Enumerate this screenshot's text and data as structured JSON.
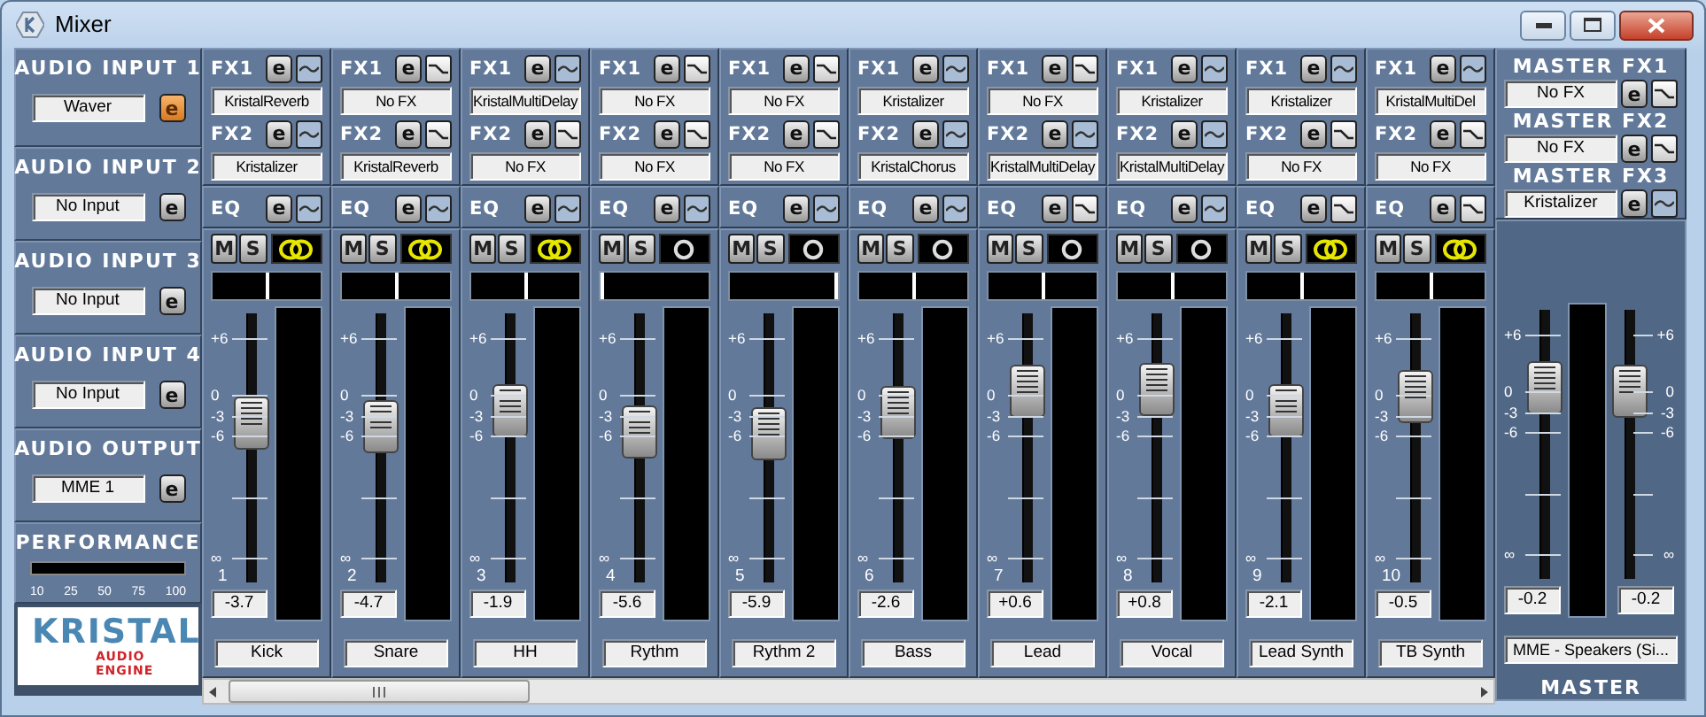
{
  "window": {
    "title": "Mixer"
  },
  "left_panel": {
    "sections": [
      {
        "kind": "device",
        "title": "AUDIO INPUT 1",
        "device": "Waver",
        "edit": "e",
        "active": true
      },
      {
        "kind": "device",
        "title": "AUDIO INPUT 2",
        "device": "No Input",
        "edit": "e",
        "active": false
      },
      {
        "kind": "device",
        "title": "AUDIO INPUT 3",
        "device": "No Input",
        "edit": "e",
        "active": false
      },
      {
        "kind": "device",
        "title": "AUDIO INPUT 4",
        "device": "No Input",
        "edit": "e",
        "active": false
      },
      {
        "kind": "device",
        "title": "AUDIO OUTPUT",
        "device": "MME 1",
        "edit": "e",
        "active": false
      },
      {
        "kind": "performance",
        "title": "PERFORMANCE",
        "scale": [
          "10",
          "25",
          "50",
          "75",
          "100"
        ]
      }
    ],
    "logo": {
      "word": "KRISTAL",
      "tagline": "AUDIO ENGINE"
    }
  },
  "channels": [
    {
      "number": "1",
      "fx": [
        {
          "label": "FX1",
          "edit": "e",
          "effect": "KristalReverb",
          "on": false
        },
        {
          "label": "FX2",
          "edit": "e",
          "effect": "Kristalizer",
          "on": false
        }
      ],
      "eq": {
        "label": "EQ",
        "edit": "e",
        "on": false
      },
      "mute": "M",
      "solo": "S",
      "stereo_link": true,
      "pan": {
        "level": 0.5
      },
      "fader": {
        "level": 0.59
      },
      "scale": [
        "+6",
        "0",
        "-3",
        "-6",
        "∞"
      ],
      "value": "-3.7",
      "name": "Kick"
    },
    {
      "number": "2",
      "fx": [
        {
          "label": "FX1",
          "edit": "e",
          "effect": "No FX",
          "on": true
        },
        {
          "label": "FX2",
          "edit": "e",
          "effect": "KristalReverb",
          "on": true
        }
      ],
      "eq": {
        "label": "EQ",
        "edit": "e",
        "on": false
      },
      "mute": "M",
      "solo": "S",
      "stereo_link": true,
      "pan": {
        "level": 0.5
      },
      "fader": {
        "level": 0.58
      },
      "scale": [
        "+6",
        "0",
        "-3",
        "-6",
        "∞"
      ],
      "value": "-4.7",
      "name": "Snare"
    },
    {
      "number": "3",
      "fx": [
        {
          "label": "FX1",
          "edit": "e",
          "effect": "KristalMultiDelay",
          "on": false
        },
        {
          "label": "FX2",
          "edit": "e",
          "effect": "No FX",
          "on": true
        }
      ],
      "eq": {
        "label": "EQ",
        "edit": "e",
        "on": false
      },
      "mute": "M",
      "solo": "S",
      "stereo_link": true,
      "pan": {
        "level": 0.5
      },
      "fader": {
        "level": 0.64
      },
      "scale": [
        "+6",
        "0",
        "-3",
        "-6",
        "∞"
      ],
      "value": "-1.9",
      "name": "HH"
    },
    {
      "number": "4",
      "fx": [
        {
          "label": "FX1",
          "edit": "e",
          "effect": "No FX",
          "on": true
        },
        {
          "label": "FX2",
          "edit": "e",
          "effect": "No FX",
          "on": true
        }
      ],
      "eq": {
        "label": "EQ",
        "edit": "e",
        "on": false
      },
      "mute": "M",
      "solo": "S",
      "stereo_link": false,
      "pan": {
        "level": 0.0
      },
      "fader": {
        "level": 0.56
      },
      "scale": [
        "+6",
        "0",
        "-3",
        "-6",
        "∞"
      ],
      "value": "-5.6",
      "name": "Rythm"
    },
    {
      "number": "5",
      "fx": [
        {
          "label": "FX1",
          "edit": "e",
          "effect": "No FX",
          "on": true
        },
        {
          "label": "FX2",
          "edit": "e",
          "effect": "No FX",
          "on": true
        }
      ],
      "eq": {
        "label": "EQ",
        "edit": "e",
        "on": false
      },
      "mute": "M",
      "solo": "S",
      "stereo_link": false,
      "pan": {
        "level": 1.0
      },
      "fader": {
        "level": 0.55
      },
      "scale": [
        "+6",
        "0",
        "-3",
        "-6",
        "∞"
      ],
      "value": "-5.9",
      "name": "Rythm 2"
    },
    {
      "number": "6",
      "fx": [
        {
          "label": "FX1",
          "edit": "e",
          "effect": "Kristalizer",
          "on": false
        },
        {
          "label": "FX2",
          "edit": "e",
          "effect": "KristalChorus",
          "on": false
        }
      ],
      "eq": {
        "label": "EQ",
        "edit": "e",
        "on": false
      },
      "mute": "M",
      "solo": "S",
      "stereo_link": false,
      "pan": {
        "level": 0.5
      },
      "fader": {
        "level": 0.63
      },
      "scale": [
        "+6",
        "0",
        "-3",
        "-6",
        "∞"
      ],
      "value": "-2.6",
      "name": "Bass"
    },
    {
      "number": "7",
      "fx": [
        {
          "label": "FX1",
          "edit": "e",
          "effect": "No FX",
          "on": true
        },
        {
          "label": "FX2",
          "edit": "e",
          "effect": "KristalMultiDelay",
          "on": false
        }
      ],
      "eq": {
        "label": "EQ",
        "edit": "e",
        "on": true
      },
      "mute": "M",
      "solo": "S",
      "stereo_link": false,
      "pan": {
        "level": 0.5
      },
      "fader": {
        "level": 0.71
      },
      "scale": [
        "+6",
        "0",
        "-3",
        "-6",
        "∞"
      ],
      "value": "+0.6",
      "name": "Lead"
    },
    {
      "number": "8",
      "fx": [
        {
          "label": "FX1",
          "edit": "e",
          "effect": "Kristalizer",
          "on": false
        },
        {
          "label": "FX2",
          "edit": "e",
          "effect": "KristalMultiDelay",
          "on": false
        }
      ],
      "eq": {
        "label": "EQ",
        "edit": "e",
        "on": false
      },
      "mute": "M",
      "solo": "S",
      "stereo_link": false,
      "pan": {
        "level": 0.5
      },
      "fader": {
        "level": 0.72
      },
      "scale": [
        "+6",
        "0",
        "-3",
        "-6",
        "∞"
      ],
      "value": "+0.8",
      "name": "Vocal"
    },
    {
      "number": "9",
      "fx": [
        {
          "label": "FX1",
          "edit": "e",
          "effect": "Kristalizer",
          "on": false
        },
        {
          "label": "FX2",
          "edit": "e",
          "effect": "No FX",
          "on": true
        }
      ],
      "eq": {
        "label": "EQ",
        "edit": "e",
        "on": true
      },
      "mute": "M",
      "solo": "S",
      "stereo_link": true,
      "pan": {
        "level": 0.5
      },
      "fader": {
        "level": 0.64
      },
      "scale": [
        "+6",
        "0",
        "-3",
        "-6",
        "∞"
      ],
      "value": "-2.1",
      "name": "Lead Synth"
    },
    {
      "number": "10",
      "fx": [
        {
          "label": "FX1",
          "edit": "e",
          "effect": "KristalMultiDel",
          "on": false
        },
        {
          "label": "FX2",
          "edit": "e",
          "effect": "No FX",
          "on": true
        }
      ],
      "eq": {
        "label": "EQ",
        "edit": "e",
        "on": true
      },
      "mute": "M",
      "solo": "S",
      "stereo_link": true,
      "pan": {
        "level": 0.5
      },
      "fader": {
        "level": 0.69
      },
      "scale": [
        "+6",
        "0",
        "-3",
        "-6",
        "∞"
      ],
      "value": "-0.5",
      "name": "TB Synth"
    }
  ],
  "master": {
    "fx": [
      {
        "label": "MASTER FX1",
        "effect": "No FX",
        "edit": "e",
        "on": true
      },
      {
        "label": "MASTER FX2",
        "effect": "No FX",
        "edit": "e",
        "on": true
      },
      {
        "label": "MASTER FX3",
        "effect": "Kristalizer",
        "edit": "e",
        "on": false
      }
    ],
    "faders": [
      {
        "level": 0.71,
        "scale": [
          "+6",
          "0",
          "-3",
          "-6",
          "∞"
        ],
        "value": "-0.2"
      },
      {
        "level": 0.7,
        "scale": [
          "+6",
          "0",
          "-3",
          "-6",
          "∞"
        ],
        "value": "-0.2"
      }
    ],
    "name": "MME - Speakers (Si...",
    "title": "MASTER"
  }
}
